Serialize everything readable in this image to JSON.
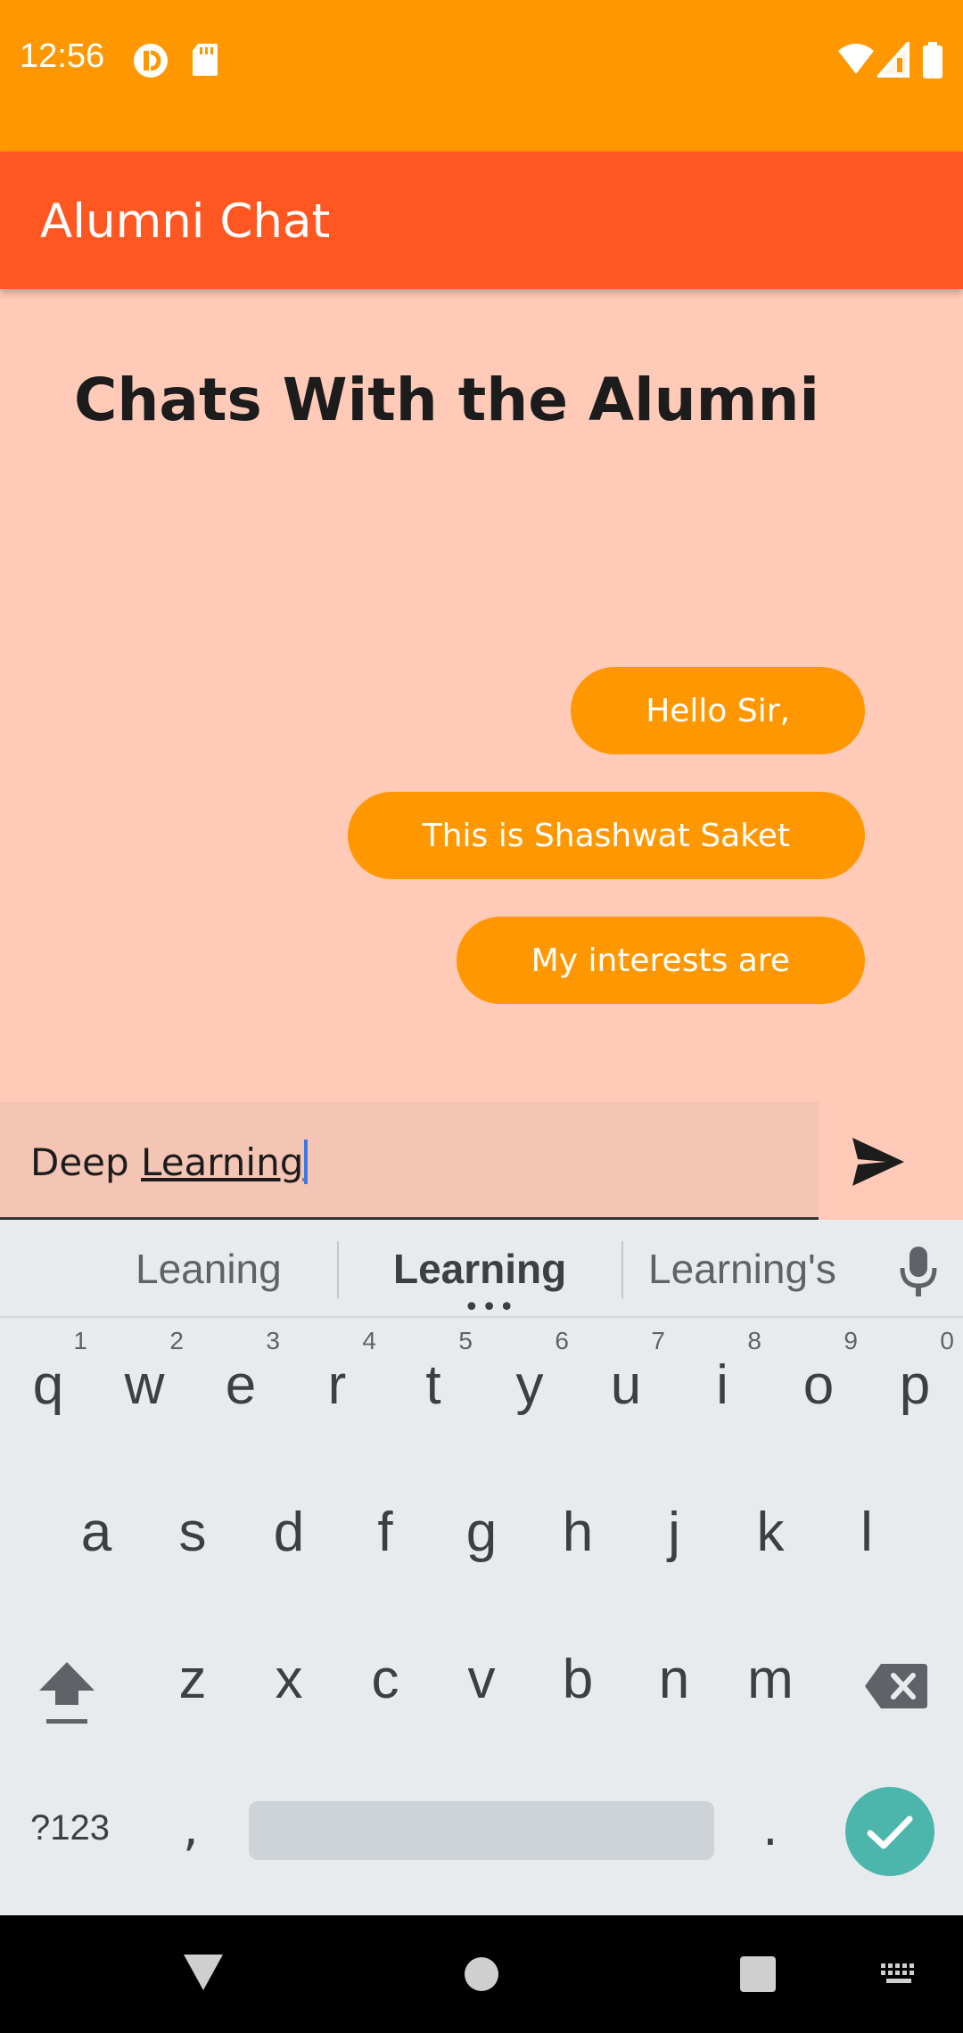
{
  "status_bar": {
    "time": "12:56"
  },
  "app_bar": {
    "title": "Alumni Chat"
  },
  "page": {
    "heading": "Chats With the Alumni"
  },
  "messages": [
    {
      "text": "Hello Sir,"
    },
    {
      "text": "This is Shashwat Saket"
    },
    {
      "text": "My interests are"
    }
  ],
  "composer": {
    "value_prefix": "Deep ",
    "value_word": "Learning"
  },
  "keyboard": {
    "suggestions": [
      "Leaning",
      "Learning",
      "Learning's"
    ],
    "row1": [
      {
        "ch": "q",
        "num": "1"
      },
      {
        "ch": "w",
        "num": "2"
      },
      {
        "ch": "e",
        "num": "3"
      },
      {
        "ch": "r",
        "num": "4"
      },
      {
        "ch": "t",
        "num": "5"
      },
      {
        "ch": "y",
        "num": "6"
      },
      {
        "ch": "u",
        "num": "7"
      },
      {
        "ch": "i",
        "num": "8"
      },
      {
        "ch": "o",
        "num": "9"
      },
      {
        "ch": "p",
        "num": "0"
      }
    ],
    "row2": [
      "a",
      "s",
      "d",
      "f",
      "g",
      "h",
      "j",
      "k",
      "l"
    ],
    "row3": [
      "z",
      "x",
      "c",
      "v",
      "b",
      "n",
      "m"
    ],
    "symbols_label": "?123",
    "comma": ",",
    "period": "."
  },
  "colors": {
    "status_bar": "#ff9800",
    "app_bar": "#ff5722",
    "background": "#ffcab8",
    "bubble": "#ff9800",
    "done_key": "#4db6ac"
  },
  "icons": {
    "send": "send-icon",
    "mic": "microphone-icon",
    "shift": "shift-icon",
    "backspace": "backspace-icon",
    "done": "checkmark-icon",
    "nav_back": "back-triangle-icon",
    "nav_home": "home-circle-icon",
    "nav_recents": "recents-square-icon",
    "nav_keyboard": "keyboard-icon"
  }
}
